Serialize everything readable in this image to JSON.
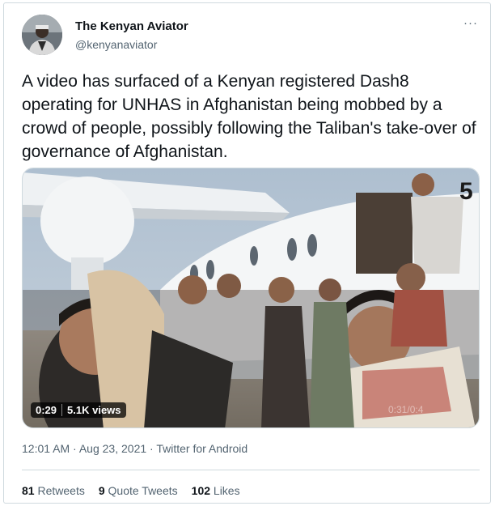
{
  "author": {
    "name": "The Kenyan Aviator",
    "handle": "@kenyanaviator",
    "avatar_icon": "pilot-avatar"
  },
  "menu": {
    "more_label": "···"
  },
  "tweet": {
    "text": "A video has surfaced of a Kenyan registered Dash8 operating for UNHAS in Afghanistan being mobbed by a crowd of people, possibly following the Taliban's take-over of governance of Afghanistan."
  },
  "media": {
    "duration": "0:29",
    "views": "5.1K views",
    "tail_number_fragment": "5",
    "watermark": "0:31/0:4"
  },
  "meta": {
    "time": "12:01 AM",
    "separator": "·",
    "date": "Aug 23, 2021",
    "client": "Twitter for Android"
  },
  "stats": {
    "retweets_count": "81",
    "retweets_label": "Retweets",
    "quotes_count": "9",
    "quotes_label": "Quote Tweets",
    "likes_count": "102",
    "likes_label": "Likes"
  },
  "colors": {
    "text_primary": "#0f1419",
    "text_secondary": "#536471",
    "border": "#cfd9de"
  }
}
